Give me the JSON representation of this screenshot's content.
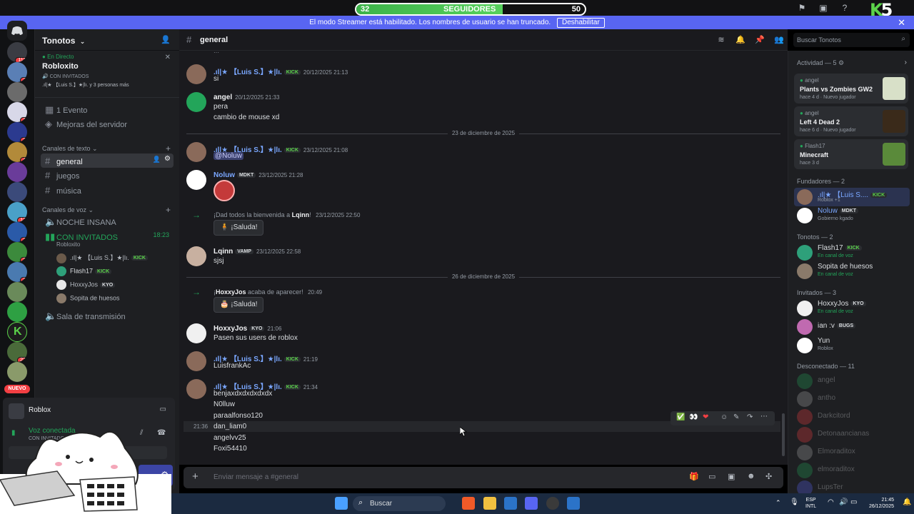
{
  "followers": {
    "current": "32",
    "label": "SEGUIDORES",
    "goal": "50",
    "progress": 0.64
  },
  "brand": {
    "logo_k": "K",
    "logo_5": "5"
  },
  "streamer_banner": {
    "text": "El modo Streamer está habilitado. Los nombres de usuario se han truncado.",
    "button": "Deshabilitar"
  },
  "rail": {
    "nuevo": "NUEVO",
    "badges": [
      "111",
      "7",
      "1",
      "3",
      "4",
      "3",
      "12",
      "3",
      "3",
      "22"
    ]
  },
  "guild": {
    "name": "Tonotos",
    "live_label": "En Directo",
    "live_title": "Robloxito",
    "live_sub": "CON INVITADOS",
    "live_users": ".ıl|★ 【Luis S.】★|lı. y 3 personas más",
    "events": "1 Evento",
    "boosts": "Mejoras del servidor",
    "text_cat": "Canales de texto",
    "text_channels": [
      "general",
      "juegos",
      "música"
    ],
    "voice_cat": "Canales de voz",
    "voice_channels": [
      "NOCHE INSANA",
      "CON INVITADOS",
      "Sala de transmisión"
    ],
    "voice_timer": "18:23",
    "voice_activity": "Robloxito",
    "voice_users": [
      {
        "name": ".ıl|★ 【Luis S.】★|lı.",
        "tag": "KICK"
      },
      {
        "name": "Flash17",
        "tag": "KICK"
      },
      {
        "name": "HoxxyJos",
        "tag": "KYO"
      },
      {
        "name": "Sopita de huesos",
        "tag": ""
      }
    ]
  },
  "user_panel": {
    "game": "Roblox",
    "voice_status": "Voz conectada",
    "voice_sub": "CON INVITADOS"
  },
  "channel": {
    "name": "general",
    "search_placeholder": "Buscar Tonotos",
    "composer_placeholder": "Enviar mensaje a #general"
  },
  "messages": [
    {
      "author": ".ıl|★ 【Luis S.】★|lı.",
      "tag": "KICK",
      "time": "20/12/2025 21:13",
      "lines": [
        "si"
      ]
    },
    {
      "author": "angel",
      "tag": "",
      "time": "20/12/2025 21:33",
      "lines": [
        "pera",
        "cambio de mouse xd"
      ]
    },
    {
      "author": ".ıl|★ 【Luis S.】★|lı.",
      "tag": "KICK",
      "time": "23/12/2025 21:08",
      "lines": [
        "@Noluw"
      ]
    },
    {
      "author": "Noluw",
      "tag": "MDKT",
      "time": "23/12/2025 21:28",
      "lines": []
    },
    {
      "author": "Lqinn",
      "tag": "VAMP",
      "time": "23/12/2025 22:58",
      "lines": [
        "sjsj"
      ]
    },
    {
      "author": "HoxxyJos",
      "tag": "KYO",
      "time": "21:06",
      "lines": [
        "Pasen sus users de roblox"
      ]
    },
    {
      "author": ".ıl|★ 【Luis S.】★|lı.",
      "tag": "KICK",
      "time": "21:19",
      "lines": [
        "LuisfrankAc"
      ]
    },
    {
      "author": ".ıl|★ 【Luis S.】★|lı.",
      "tag": "KICK",
      "time": "21:34",
      "lines": [
        "benjaxdxdxdxdxdx",
        "N0lluw",
        "paraalfonso120",
        "dan_liam0",
        "angelvv25",
        "Foxi54410"
      ]
    }
  ],
  "hover_time": "21:36",
  "dividers": [
    "23 de diciembre de 2025",
    "26 de diciembre de 2025"
  ],
  "system": [
    {
      "pre": "¡Dad todos la bienvenida a",
      "who": "Lqinn",
      "post": "!",
      "time": "23/12/2025 22:50",
      "button": "¡Saluda!"
    },
    {
      "pre": "¡",
      "who": "HoxxyJos",
      "post": " acaba de aparecer!",
      "time": "20:49",
      "button": "¡Saluda!"
    }
  ],
  "members": {
    "activity_header": "Actividad — 5",
    "activities": [
      {
        "who": "angel",
        "game": "Plants vs Zombies GW2",
        "when": "hace 4 d",
        "extra": "Nuevo jugador"
      },
      {
        "who": "angel",
        "game": "Left 4 Dead 2",
        "when": "hace 6 d",
        "extra": "Nuevo jugador"
      },
      {
        "who": "Flash17",
        "game": "Minecraft",
        "when": "hace 3 d",
        "extra": ""
      }
    ],
    "founders_header": "Fundadores — 2",
    "founders": [
      {
        "name": ".ıl|★ 【Luis S....",
        "tag": "KICK",
        "sub": "Roblox +1"
      },
      {
        "name": "Noluw",
        "tag": "MDKT",
        "sub": "Gobierno kgado"
      }
    ],
    "tonotos_header": "Tonotos — 2",
    "tonotos": [
      {
        "name": "Flash17",
        "tag": "KICK",
        "sub": "En canal de voz"
      },
      {
        "name": "Sopita de huesos",
        "tag": "",
        "sub": "En canal de voz"
      }
    ],
    "guests_header": "Invitados — 3",
    "guests": [
      {
        "name": "HoxxyJos",
        "tag": "KYO",
        "sub": "En canal de voz"
      },
      {
        "name": "ian :v",
        "tag": "BUGS",
        "sub": ""
      },
      {
        "name": "Yun",
        "tag": "",
        "sub": "Roblox"
      }
    ],
    "offline_header": "Desconectado — 11",
    "offline": [
      "angel",
      "antho",
      "Darkcitord",
      "Detonaancianas",
      "Elmoraditox",
      "elmoraditox",
      "LupsTer"
    ]
  },
  "taskbar": {
    "search": "Buscar",
    "lang1": "ESP",
    "lang2": "INTL",
    "time": "21:45",
    "date": "26/12/2025"
  },
  "colors": {
    "accent": "#5865f2",
    "kick_green": "#5bd34a",
    "luis_color": "#7aa7ff",
    "noluw_color": "#7aa7ff"
  }
}
